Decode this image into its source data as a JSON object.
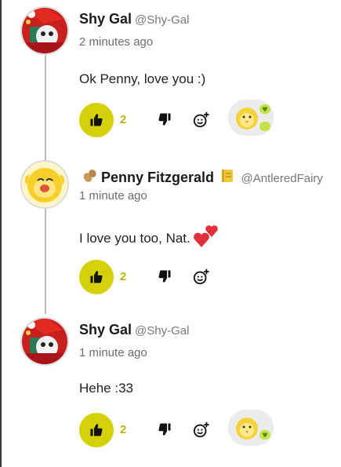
{
  "comments": [
    {
      "name": "Shy Gal",
      "handle": "@Shy-Gal",
      "time": "2 minutes ago",
      "text": "Ok Penny, love you :)",
      "likes": "2"
    },
    {
      "name": "Penny Fitzgerald",
      "handle": "@AntleredFairy",
      "time": "1 minute ago",
      "text": "I love you too, Nat.",
      "likes": "2"
    },
    {
      "name": "Shy Gal",
      "handle": "@Shy-Gal",
      "time": "1 minute ago",
      "text": "Hehe :33",
      "likes": "2"
    }
  ],
  "colors": {
    "accent": "#d4d10a",
    "like_count": "#b8b50c",
    "heart": "#e0303a",
    "reaction_badge": "#c6e24a",
    "thread_line": "#b9b9b9"
  },
  "icons": {
    "like": "thumbs-up-icon",
    "dislike": "thumbs-down-icon",
    "react": "add-reaction-icon",
    "penny_flair": "peanut-icon",
    "penny_badge": "notebook-icon"
  }
}
